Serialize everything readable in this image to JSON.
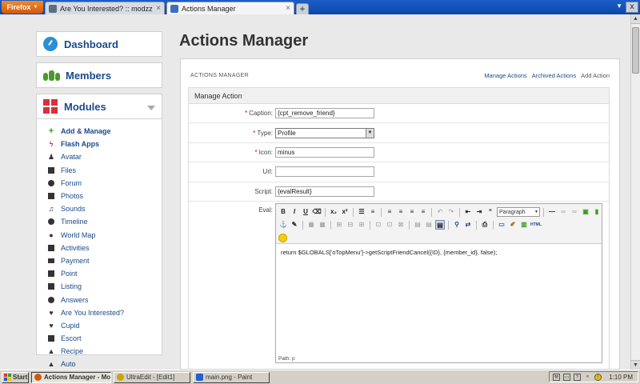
{
  "browser": {
    "menu_label": "Firefox",
    "tabs": [
      {
        "title": "Are You Interested? :: modzzz",
        "active": false
      },
      {
        "title": "Actions Manager",
        "active": true
      }
    ],
    "new_tab": "+",
    "close": "x"
  },
  "sidebar": {
    "dashboard": "Dashboard",
    "members": "Members",
    "modules": "Modules",
    "items": [
      {
        "label": "Add & Manage",
        "icon": "plus-icon",
        "bold": true
      },
      {
        "label": "Flash Apps",
        "icon": "lightning-icon",
        "bold": true
      },
      {
        "label": "Avatar",
        "icon": "user-icon"
      },
      {
        "label": "Files",
        "icon": "file-icon"
      },
      {
        "label": "Forum",
        "icon": "chat-icon"
      },
      {
        "label": "Photos",
        "icon": "photo-icon"
      },
      {
        "label": "Sounds",
        "icon": "music-icon"
      },
      {
        "label": "Timeline",
        "icon": "clock-icon"
      },
      {
        "label": "World Map",
        "icon": "map-marker-icon"
      },
      {
        "label": "Activities",
        "icon": "calendar-icon"
      },
      {
        "label": "Payment",
        "icon": "credit-card-icon"
      },
      {
        "label": "Point",
        "icon": "point-icon"
      },
      {
        "label": "Listing",
        "icon": "briefcase-icon"
      },
      {
        "label": "Answers",
        "icon": "question-icon"
      },
      {
        "label": "Are You Interested?",
        "icon": "heart-icon"
      },
      {
        "label": "Cupid",
        "icon": "heart-icon"
      },
      {
        "label": "Escort",
        "icon": "group-icon"
      },
      {
        "label": "Recipe",
        "icon": "flask-icon"
      },
      {
        "label": "Auto",
        "icon": "car-icon"
      }
    ]
  },
  "main": {
    "title": "Actions Manager",
    "panel_header": "ACTIONS MANAGER",
    "links": {
      "manage": "Manage Actions",
      "archived": "Archived Actions",
      "add": "Add Action"
    },
    "form": {
      "title": "Manage Action",
      "caption_label": "Caption:",
      "caption_value": "{cpt_remove_friend}",
      "type_label": "Type:",
      "type_value": "Profile",
      "icon_label": "Icon:",
      "icon_value": "minus",
      "url_label": "Url:",
      "url_value": "",
      "script_label": "Script:",
      "script_value": "{evalResult}",
      "eval_label": "Eval:",
      "eval_content": "return $GLOBALS['oTopMenu']->getScriptFriendCancel({ID}, {member_id}, false);",
      "editor_format": "Paragraph",
      "editor_path": "Path: p"
    }
  },
  "taskbar": {
    "start": "Start",
    "tasks": [
      {
        "label": "Actions Manager - Mo...",
        "active": true
      },
      {
        "label": "UltraEdit - [Edit1]",
        "active": false
      },
      {
        "label": "main.png - Paint",
        "active": false
      }
    ],
    "clock": "1:10 PM"
  }
}
